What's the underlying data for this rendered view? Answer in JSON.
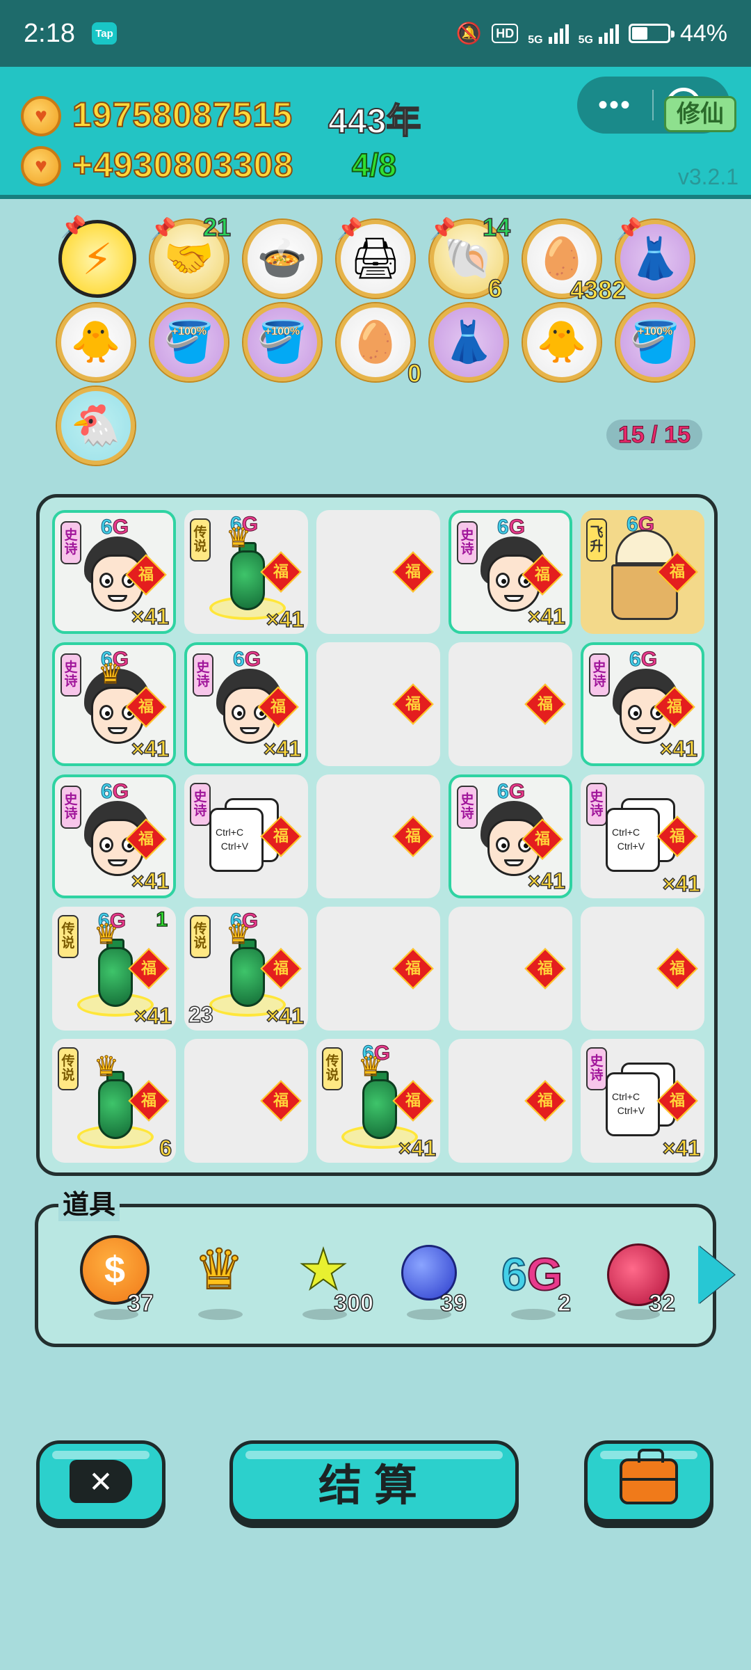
{
  "status_bar": {
    "time": "2:18",
    "tap_badge": "Tap",
    "hd_label": "HD",
    "net1": "5G",
    "net2": "5G",
    "battery": "44%"
  },
  "header": {
    "money": "19758087515",
    "income": "+4930803308",
    "year": "443年",
    "ratio": "4/8",
    "mode_label": "修仙",
    "version": "v3.2.1"
  },
  "items_row": [
    {
      "icon": "lightning-icon",
      "glyph": "⚡"
    },
    {
      "icon": "handshake-icon",
      "glyph": "🤝",
      "count": "21"
    },
    {
      "icon": "rice-cooker-icon",
      "glyph": "🍲"
    },
    {
      "icon": "printer-icon",
      "glyph": "🖨"
    },
    {
      "icon": "shell-icon",
      "glyph": "🐚",
      "count": "14",
      "count2": "6"
    },
    {
      "icon": "egg-tray-icon",
      "glyph": "🥚",
      "count2": "4382"
    },
    {
      "icon": "skirt-icon",
      "glyph": "👗"
    },
    {
      "icon": "chick-icon",
      "glyph": "🐥"
    },
    {
      "icon": "bucket-icon",
      "glyph": "🪣",
      "pct": "+100%"
    },
    {
      "icon": "bucket-icon",
      "glyph": "🪣",
      "pct": "+100%"
    },
    {
      "icon": "egg-tray-icon",
      "glyph": "🥚",
      "count2": "0"
    },
    {
      "icon": "skirt-icon",
      "glyph": "👗"
    },
    {
      "icon": "chick-icon",
      "glyph": "🐥"
    },
    {
      "icon": "bucket-icon",
      "glyph": "🪣",
      "pct": "+100%"
    },
    {
      "icon": "chicken-syringe-icon",
      "glyph": "🐔"
    }
  ],
  "slot_count": "15 / 15",
  "grid": {
    "fu_label": "福",
    "g6_six": "6",
    "g6_g": "G",
    "tags": {
      "epic": "史诗",
      "legend": "传说",
      "fly": "飞升"
    },
    "copy_text1": "Ctrl+C",
    "copy_text2": "Ctrl+V",
    "multiplier": "×41",
    "extra_num1": "1",
    "extra_num2": "23",
    "extra_num3": "6"
  },
  "props": {
    "title": "道具",
    "items": [
      {
        "name": "dollar-coin",
        "symbol": "$",
        "count": "37"
      },
      {
        "name": "crown",
        "count": ""
      },
      {
        "name": "star",
        "count": "300"
      },
      {
        "name": "blueberry",
        "count": "39"
      },
      {
        "name": "6g",
        "count": "2"
      },
      {
        "name": "lychee",
        "count": "32"
      }
    ]
  },
  "buttons": {
    "settle": "结算",
    "close_symbol": "✕"
  }
}
